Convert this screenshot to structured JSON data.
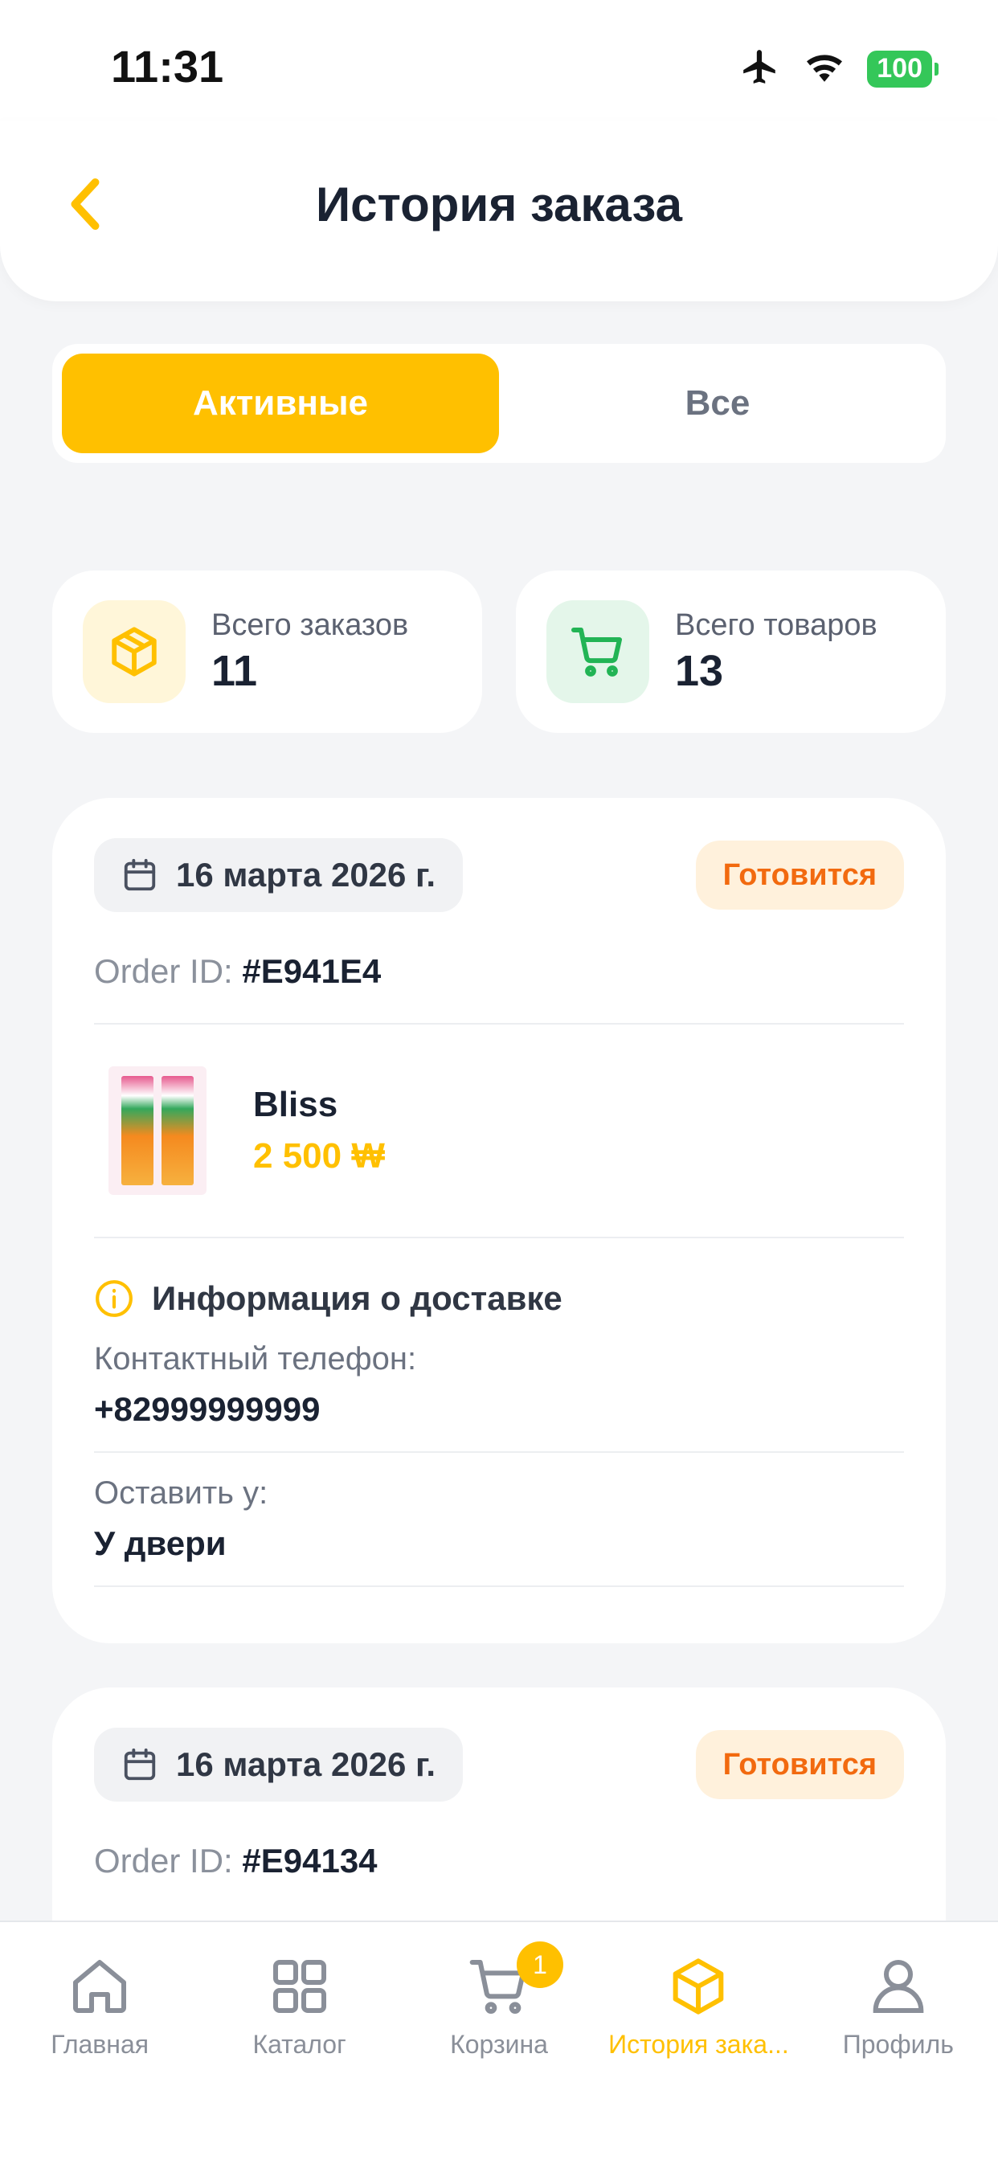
{
  "status_bar": {
    "time": "11:31",
    "battery": "100"
  },
  "header": {
    "title": "История заказа"
  },
  "segments": {
    "active": "Активные",
    "all": "Все"
  },
  "stats": {
    "orders": {
      "label": "Всего заказов",
      "value": "11",
      "icon": "box-icon"
    },
    "items": {
      "label": "Всего товаров",
      "value": "13",
      "icon": "cart-icon"
    }
  },
  "orders": [
    {
      "date": "16 марта 2026 г.",
      "status": "Готовится",
      "id_label": "Order ID:",
      "id": "#E941E4",
      "product": {
        "name": "Bliss",
        "price": "2 500 ₩"
      },
      "delivery_title": "Информация о доставке",
      "phone_label": "Контактный телефон:",
      "phone": "+82999999999",
      "leave_label": "Оставить у:",
      "leave": "У двери"
    },
    {
      "date": "16 марта 2026 г.",
      "status": "Готовится",
      "id_label": "Order ID:",
      "id": "#E94134"
    }
  ],
  "tabbar": {
    "home": "Главная",
    "catalog": "Каталог",
    "cart": "Корзина",
    "cart_badge": "1",
    "history": "История зака...",
    "profile": "Профиль"
  },
  "colors": {
    "accent": "#ffc000",
    "status": "#f26a0f",
    "green": "#22b455"
  }
}
